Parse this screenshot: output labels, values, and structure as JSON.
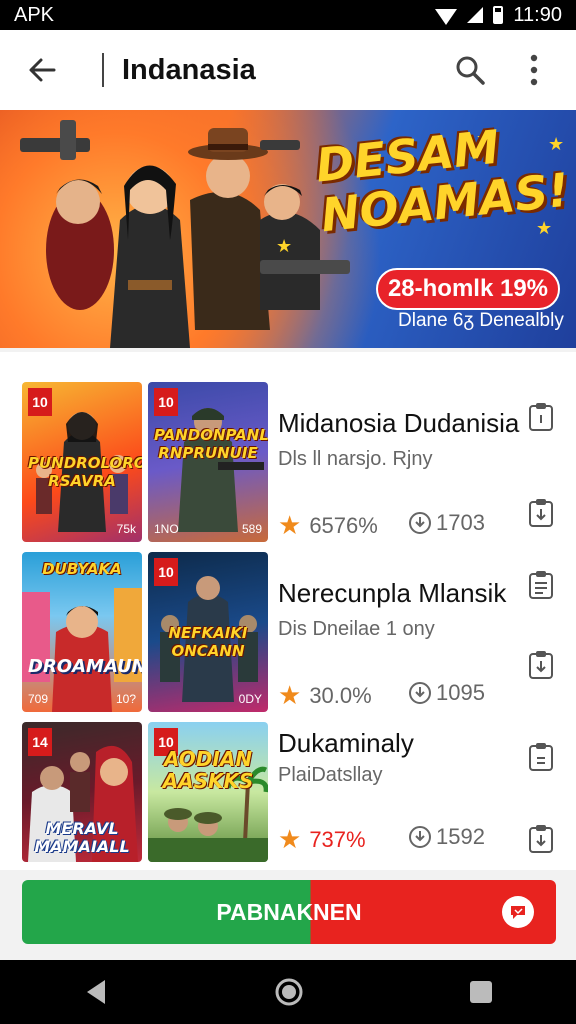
{
  "status_bar": {
    "app": "APK",
    "time": "11:90"
  },
  "app_bar": {
    "title": "Indanasia"
  },
  "banner": {
    "headline_line1": "DESAM",
    "headline_line2": "NOAMAS!",
    "pill": "28-homlk 19%",
    "subtext": "Dlane 6ᵹ Denealbly"
  },
  "items": [
    {
      "title": "Midanosia Dudanisia",
      "subtitle": "Dls ll narsjo. Rjny",
      "rating": "6576%",
      "count": "1703",
      "thumb1": {
        "badge": "10",
        "caption": "PUNDROLORO RSAVRA",
        "foot_right": "75k"
      },
      "thumb2": {
        "badge": "10",
        "caption": "PANDONPANL RNPRUNUIE",
        "foot_left": "1NO",
        "foot_right": "589"
      }
    },
    {
      "title": "Nerecunpla Mlansik",
      "subtitle": "Dis Dneilae 1 ony",
      "rating": "30.0%",
      "count": "1095",
      "thumb1": {
        "badge": "",
        "caption": "DROAMAUN",
        "top_caption": "DUBYAKA",
        "foot_left": "709",
        "foot_right": "10?"
      },
      "thumb2": {
        "badge": "10",
        "caption": "NEFKAIKI ONCANN",
        "foot_right": "0DY"
      }
    },
    {
      "title": "Dukaminaly",
      "subtitle": "PlaiDatsllay",
      "rating": "737%",
      "count": "1592",
      "thumb1": {
        "badge": "14",
        "caption": "MERAVL MAMAIALL"
      },
      "thumb2": {
        "badge": "10",
        "caption": "AODIAN AASKKS"
      }
    }
  ],
  "cta": {
    "label": "PABNAKNEN"
  },
  "colors": {
    "accent_red": "#e8231f",
    "accent_green": "#23a64a",
    "star_orange": "#f08a1c"
  }
}
